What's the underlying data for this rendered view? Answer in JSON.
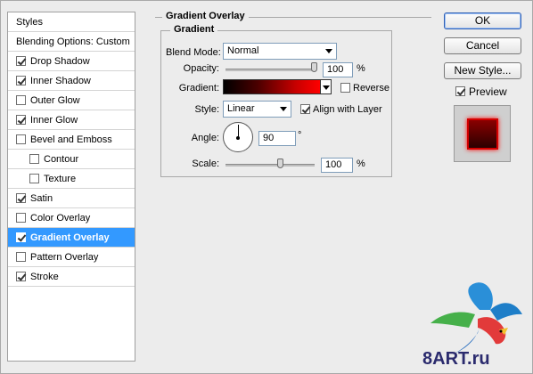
{
  "styles_panel": {
    "header": "Styles",
    "blending_options": "Blending Options: Custom",
    "items": [
      {
        "label": "Drop Shadow",
        "checked": true,
        "indent": false,
        "selected": false
      },
      {
        "label": "Inner Shadow",
        "checked": true,
        "indent": false,
        "selected": false
      },
      {
        "label": "Outer Glow",
        "checked": false,
        "indent": false,
        "selected": false
      },
      {
        "label": "Inner Glow",
        "checked": true,
        "indent": false,
        "selected": false
      },
      {
        "label": "Bevel and Emboss",
        "checked": false,
        "indent": false,
        "selected": false
      },
      {
        "label": "Contour",
        "checked": false,
        "indent": true,
        "selected": false
      },
      {
        "label": "Texture",
        "checked": false,
        "indent": true,
        "selected": false
      },
      {
        "label": "Satin",
        "checked": true,
        "indent": false,
        "selected": false
      },
      {
        "label": "Color Overlay",
        "checked": false,
        "indent": false,
        "selected": false
      },
      {
        "label": "Gradient Overlay",
        "checked": true,
        "indent": false,
        "selected": true
      },
      {
        "label": "Pattern Overlay",
        "checked": false,
        "indent": false,
        "selected": false
      },
      {
        "label": "Stroke",
        "checked": true,
        "indent": false,
        "selected": false
      }
    ]
  },
  "panel": {
    "section_title": "Gradient Overlay",
    "group_title": "Gradient",
    "blend_mode_label": "Blend Mode:",
    "blend_mode_value": "Normal",
    "opacity_label": "Opacity:",
    "opacity_value": "100",
    "opacity_unit": "%",
    "opacity_level": 1.0,
    "gradient_label": "Gradient:",
    "reverse_label": "Reverse",
    "reverse_checked": false,
    "style_label": "Style:",
    "style_value": "Linear",
    "align_label": "Align with Layer",
    "align_checked": true,
    "angle_label": "Angle:",
    "angle_value": "90",
    "angle_unit": "°",
    "scale_label": "Scale:",
    "scale_value": "100",
    "scale_unit": "%",
    "gradient_colors": [
      "#000000",
      "#ff0000"
    ]
  },
  "buttons": {
    "ok": "OK",
    "cancel": "Cancel",
    "new_style": "New Style...",
    "preview_label": "Preview",
    "preview_checked": true
  },
  "watermark": "8ART.ru",
  "colors": {
    "selection": "#3399ff",
    "preview_red": "#d40000"
  }
}
